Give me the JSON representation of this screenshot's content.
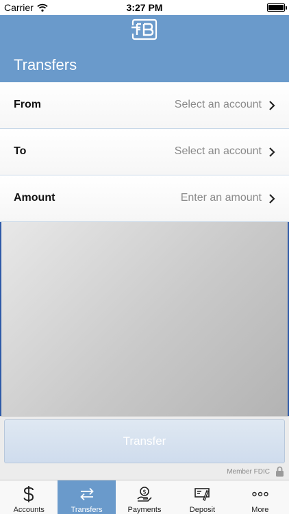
{
  "status_bar": {
    "carrier": "Carrier",
    "time": "3:27 PM"
  },
  "header": {
    "title": "Transfers",
    "logo_icon": "fb-logo-icon"
  },
  "form": {
    "from": {
      "label": "From",
      "placeholder": "Select an account"
    },
    "to": {
      "label": "To",
      "placeholder": "Select an account"
    },
    "amount": {
      "label": "Amount",
      "placeholder": "Enter an amount"
    }
  },
  "transfer_button": {
    "label": "Transfer"
  },
  "footer": {
    "fdic": "Member FDIC"
  },
  "tabs": [
    {
      "label": "Accounts",
      "icon": "dollar-icon",
      "active": false
    },
    {
      "label": "Transfers",
      "icon": "transfer-arrows-icon",
      "active": true
    },
    {
      "label": "Payments",
      "icon": "payment-hand-icon",
      "active": false
    },
    {
      "label": "Deposit",
      "icon": "check-deposit-icon",
      "active": false
    },
    {
      "label": "More",
      "icon": "more-dots-icon",
      "active": false
    }
  ],
  "colors": {
    "brand": "#6a9acb",
    "panel_border": "#2e5aa8",
    "muted_text": "#8a8a8a"
  }
}
